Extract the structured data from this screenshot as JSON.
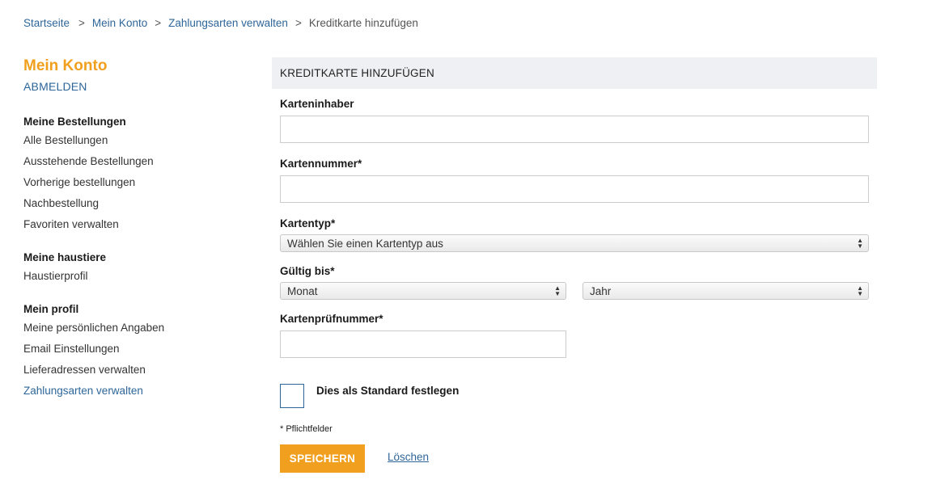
{
  "breadcrumb": {
    "home": "Startseite",
    "sep": ">",
    "account": "Mein Konto",
    "payments": "Zahlungsarten verwalten",
    "current": "Kreditkarte hinzufügen"
  },
  "sidebar": {
    "title": "Mein Konto",
    "logout": "ABMELDEN",
    "groups": [
      {
        "heading": "Meine Bestellungen",
        "items": [
          "Alle Bestellungen",
          "Ausstehende Bestellungen",
          "Vorherige bestellungen",
          "Nachbestellung",
          "Favoriten verwalten"
        ]
      },
      {
        "heading": "Meine haustiere",
        "items": [
          "Haustierprofil"
        ]
      },
      {
        "heading": "Mein profil",
        "items": [
          "Meine persönlichen Angaben",
          "Email Einstellungen",
          "Lieferadressen verwalten",
          "Zahlungsarten verwalten"
        ]
      }
    ]
  },
  "form": {
    "header": "KREDITKARTE HINZUFÜGEN",
    "cardholder_label": "Karteninhaber",
    "cardholder_value": "",
    "cardnumber_label": "Kartennummer*",
    "cardnumber_value": "",
    "cardtype_label": "Kartentyp*",
    "cardtype_selected": "Wählen Sie einen Kartentyp aus",
    "expiry_label": "Gültig bis*",
    "month_selected": "Monat",
    "year_selected": "Jahr",
    "cvv_label": "Kartenprüfnummer*",
    "cvv_value": "",
    "default_label": "Dies als Standard festlegen",
    "required_note": "* Pflichtfelder",
    "save_label": "SPEICHERN",
    "delete_label": "Löschen"
  },
  "colors": {
    "accent": "#f0a01e",
    "link": "#2e6699",
    "panel_header_bg": "#eef0f3"
  }
}
